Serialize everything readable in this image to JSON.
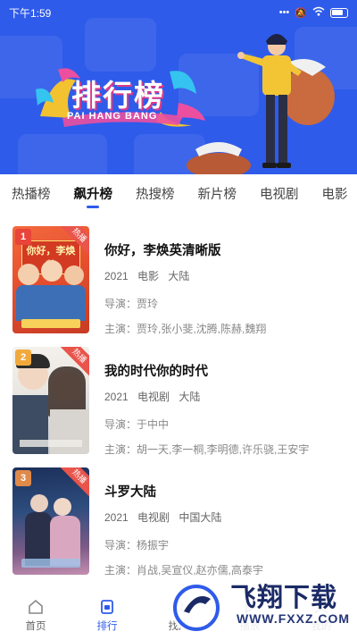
{
  "status_bar": {
    "time": "下午1:59"
  },
  "banner": {
    "title": "排行榜",
    "subtitle": "PAI HANG BANG"
  },
  "tabs": [
    "热播榜",
    "飙升榜",
    "热搜榜",
    "新片榜",
    "电视剧",
    "电影"
  ],
  "active_tab": "飙升榜",
  "items": [
    {
      "rank": "1",
      "corner": "热播",
      "title": "你好，李焕英清晰版",
      "year": "2021",
      "type": "电影",
      "region": "大陆",
      "director": "导演：贾玲",
      "actors": "主演：贾玲,张小斐,沈腾,陈赫,魏翔",
      "poster_text": "你好，李焕英"
    },
    {
      "rank": "2",
      "corner": "热播",
      "title": "我的时代你的时代",
      "year": "2021",
      "type": "电视剧",
      "region": "大陆",
      "director": "导演：于中中",
      "actors": "主演：胡一天,李一桐,李明德,许乐骁,王安宇",
      "poster_text": ""
    },
    {
      "rank": "3",
      "corner": "热播",
      "title": "斗罗大陆",
      "year": "2021",
      "type": "电视剧",
      "region": "中国大陆",
      "director": "导演：杨振宇",
      "actors": "主演：肖战,吴宣仪,赵亦儒,高泰宇",
      "poster_text": ""
    }
  ],
  "bottom_nav": [
    {
      "label": "首页",
      "icon": "home-icon"
    },
    {
      "label": "排行",
      "icon": "ranking-icon"
    },
    {
      "label": "找片",
      "icon": "search-icon"
    },
    {
      "label": "播放",
      "icon": "play-icon"
    },
    {
      "label": "我的",
      "icon": "user-icon"
    }
  ],
  "watermark": {
    "title": "飞翔下载",
    "url": "WWW.FXXZ.COM"
  },
  "colors": {
    "accent": "#2f5bea",
    "corner_badge": "#e9544b"
  }
}
